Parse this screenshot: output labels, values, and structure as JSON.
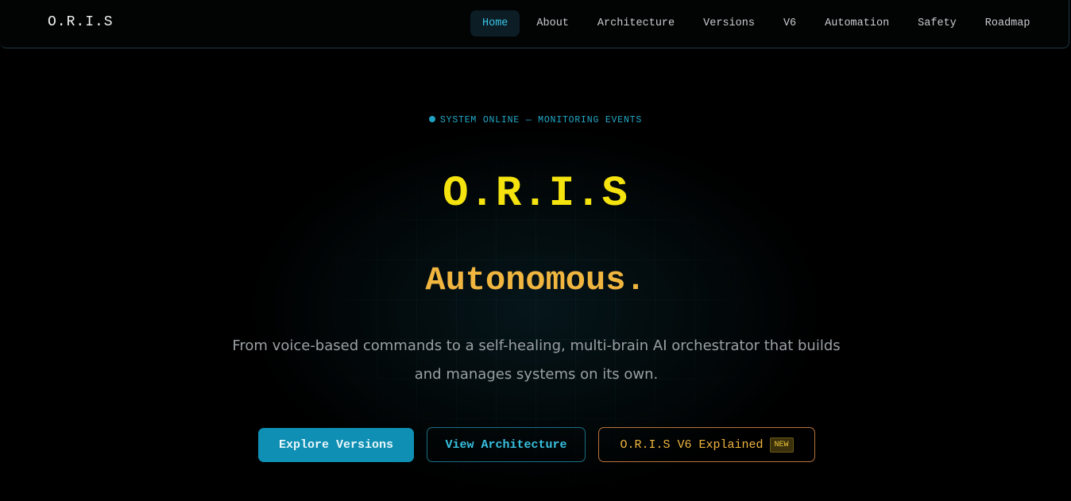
{
  "navbar": {
    "brand": "O.R.I.S",
    "items": [
      {
        "label": "Home",
        "active": true
      },
      {
        "label": "About"
      },
      {
        "label": "Architecture"
      },
      {
        "label": "Versions"
      },
      {
        "label": "V6"
      },
      {
        "label": "Automation"
      },
      {
        "label": "Safety"
      },
      {
        "label": "Roadmap"
      }
    ]
  },
  "hero": {
    "status": "SYSTEM ONLINE — MONITORING EVENTS",
    "title": "O.R.I.S",
    "subtitle": "Autonomous.",
    "description": "From voice-based commands to a self-healing, multi-brain AI orchestrator that builds and manages systems on its own.",
    "buttons": {
      "explore": "Explore Versions",
      "architecture": "View Architecture",
      "v6": "O.R.I.S V6 Explained",
      "v6_badge": "NEW"
    }
  },
  "colors": {
    "background": "#000000",
    "accent_cyan": "#0e8fb3",
    "title_yellow": "#f4e30e",
    "subtitle_amber": "#f0b63f"
  }
}
